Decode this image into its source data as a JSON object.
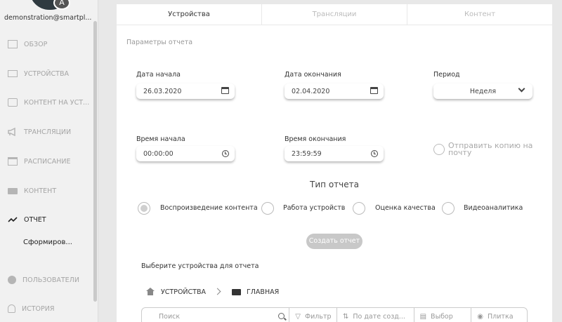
{
  "sidebar": {
    "user_email": "demonstration@smartpl...",
    "avatar_letter": "A",
    "items": [
      {
        "label": "ОБЗОР",
        "icon": "dashboard-icon"
      },
      {
        "label": "УСТРОЙСТВА",
        "icon": "monitor-icon"
      },
      {
        "label": "КОНТЕНТ НА УСТ...",
        "icon": "screen-content-icon"
      },
      {
        "label": "ТРАНСЛЯЦИИ",
        "icon": "megaphone-icon"
      },
      {
        "label": "РАСПИСАНИЕ",
        "icon": "calendar-icon"
      },
      {
        "label": "КОНТЕНТ",
        "icon": "folder-icon"
      },
      {
        "label": "ОТЧЕТ",
        "icon": "chart-line-icon",
        "active": true
      },
      {
        "label": "ПОЛЬЗОВАТЕЛИ",
        "icon": "user-icon"
      },
      {
        "label": "ИСТОРИЯ",
        "icon": "bell-icon"
      }
    ],
    "sub_item": "Сформиров..."
  },
  "tabs": [
    "Устройства",
    "Трансляции",
    "Контент"
  ],
  "active_tab": "Устройства",
  "report": {
    "section_title": "Параметры отчета",
    "start_date_label": "Дата начала",
    "start_date": "26.03.2020",
    "end_date_label": "Дата окончания",
    "end_date": "02.04.2020",
    "period_label": "Период",
    "period_value": "Неделя",
    "start_time_label": "Время начала",
    "start_time": "00:00:00",
    "end_time_label": "Время окончания",
    "end_time": "23:59:59",
    "send_copy_line1": "Отправить копию на",
    "send_copy_line2": "почту",
    "send_copy_checked": false,
    "type_title": "Тип отчета",
    "types": [
      {
        "label": "Воспроизведение контента",
        "selected": true
      },
      {
        "label": "Работа устройств",
        "selected": false
      },
      {
        "label": "Оценка качества",
        "selected": false
      },
      {
        "label": "Видеоаналитика",
        "selected": false
      }
    ],
    "create_button": "Создать отчет",
    "choose_devices_label": "Выберите устройства для отчета"
  },
  "breadcrumb": {
    "root": "УСТРОЙСТВА",
    "current": "ГЛАВНАЯ"
  },
  "toolbar": {
    "search_placeholder": "Поиск",
    "filter": "Фильтр",
    "sort": "По дате созд...",
    "select": "Выбор",
    "view": "Плитка"
  }
}
